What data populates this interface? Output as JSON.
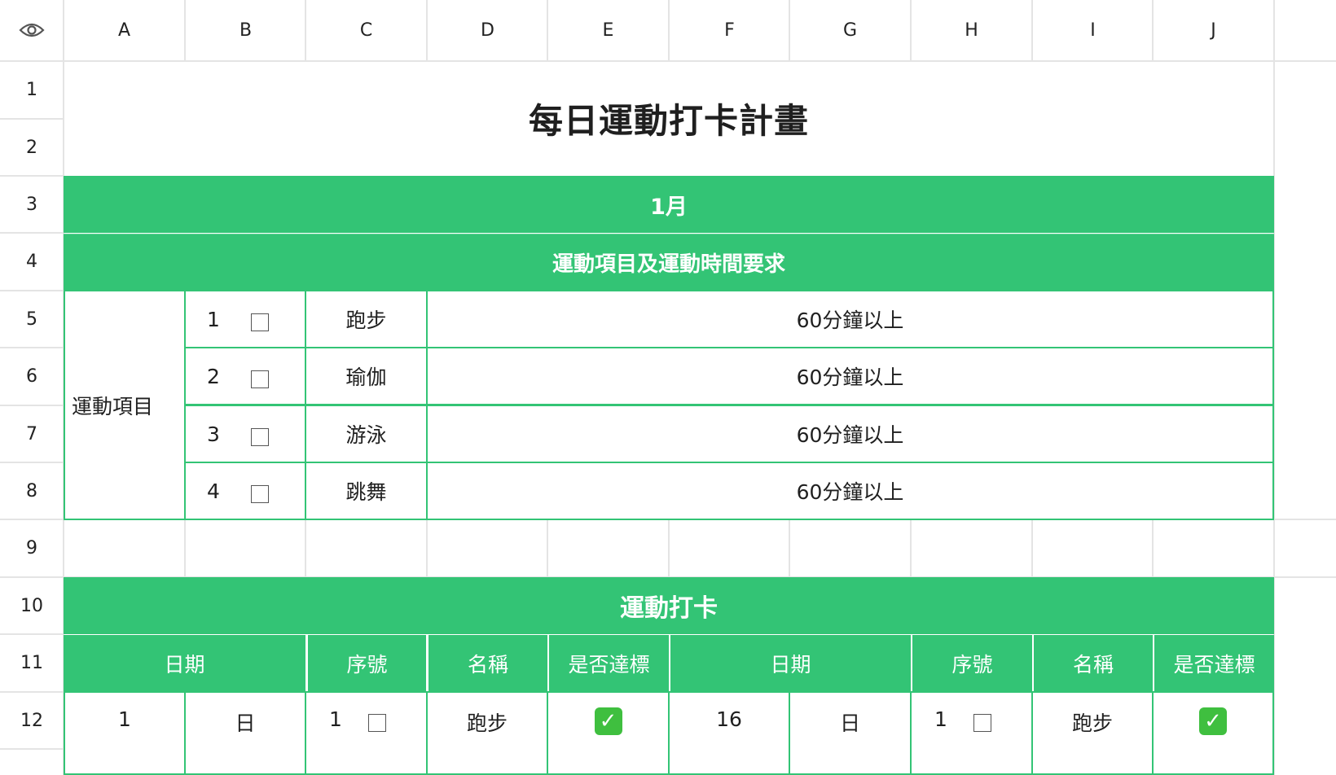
{
  "columns": [
    "A",
    "B",
    "C",
    "D",
    "E",
    "F",
    "G",
    "H",
    "I",
    "J"
  ],
  "rows": [
    "1",
    "2",
    "3",
    "4",
    "5",
    "6",
    "7",
    "8",
    "9",
    "10",
    "11",
    "12"
  ],
  "title": "每日運動打卡計畫",
  "month": "1月",
  "requirement_header": "運動項目及運動時間要求",
  "items_label": "運動項目",
  "items": [
    {
      "num": "1",
      "name": "跑步",
      "time": "60分鐘以上",
      "checked": false
    },
    {
      "num": "2",
      "name": "瑜伽",
      "time": "60分鐘以上",
      "checked": false
    },
    {
      "num": "3",
      "name": "游泳",
      "time": "60分鐘以上",
      "checked": false
    },
    {
      "num": "4",
      "name": "跳舞",
      "time": "60分鐘以上",
      "checked": false
    }
  ],
  "checkin_header": "運動打卡",
  "table_headers": {
    "left": {
      "date": "日期",
      "seq": "序號",
      "name": "名稱",
      "ok": "是否達標"
    },
    "right": {
      "date": "日期",
      "seq": "序號",
      "name": "名稱",
      "ok": "是否達標"
    }
  },
  "row12": {
    "left": {
      "day": "1",
      "weekday": "日",
      "seq": "1",
      "name": "跑步",
      "ok": "✓"
    },
    "right": {
      "day": "16",
      "weekday": "日",
      "seq": "1",
      "name": "跑步",
      "ok": "✓"
    }
  },
  "colors": {
    "accent": "#33c475",
    "check": "#3fbf3f",
    "grid": "#e4e4e4"
  },
  "icons": {
    "corner": "eye-icon",
    "checkbox": "checkbox-icon",
    "done": "check-mark-icon"
  }
}
